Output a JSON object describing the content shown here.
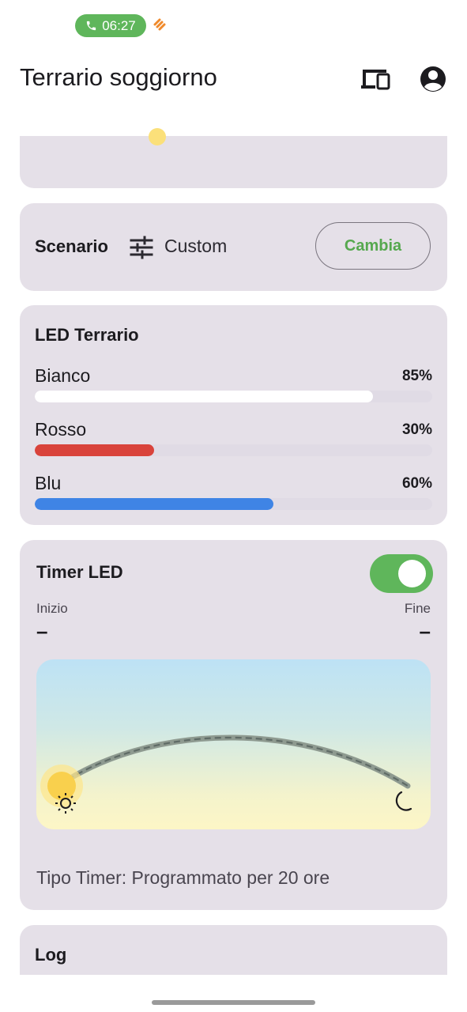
{
  "status_bar": {
    "call_time": "06:27",
    "call_icon": "phone-icon",
    "extra_icon": "app-notification-icon",
    "accent": "#5fb65b"
  },
  "app_bar": {
    "title": "Terrario soggiorno",
    "icons": [
      "devices-icon",
      "account-circle-icon"
    ]
  },
  "scenario": {
    "label": "Scenario",
    "icon": "tune-icon",
    "value": "Custom",
    "button_label": "Cambia"
  },
  "led": {
    "title": "LED Terrario",
    "channels": [
      {
        "name": "Bianco",
        "percent_label": "85%",
        "level": 0.85,
        "color": "#ffffff"
      },
      {
        "name": "Rosso",
        "percent_label": "30%",
        "level": 0.3,
        "color": "#d9433b"
      },
      {
        "name": "Blu",
        "percent_label": "60%",
        "level": 0.6,
        "color": "#3f84e5"
      }
    ]
  },
  "timer": {
    "title": "Timer LED",
    "enabled": true,
    "start_label": "Inizio",
    "start_value": "–",
    "end_label": "Fine",
    "end_value": "–",
    "icons": [
      "sun-icon",
      "moon-icon"
    ],
    "type_text": "Tipo Timer: Programmato per 20 ore"
  },
  "log": {
    "title": "Log"
  }
}
